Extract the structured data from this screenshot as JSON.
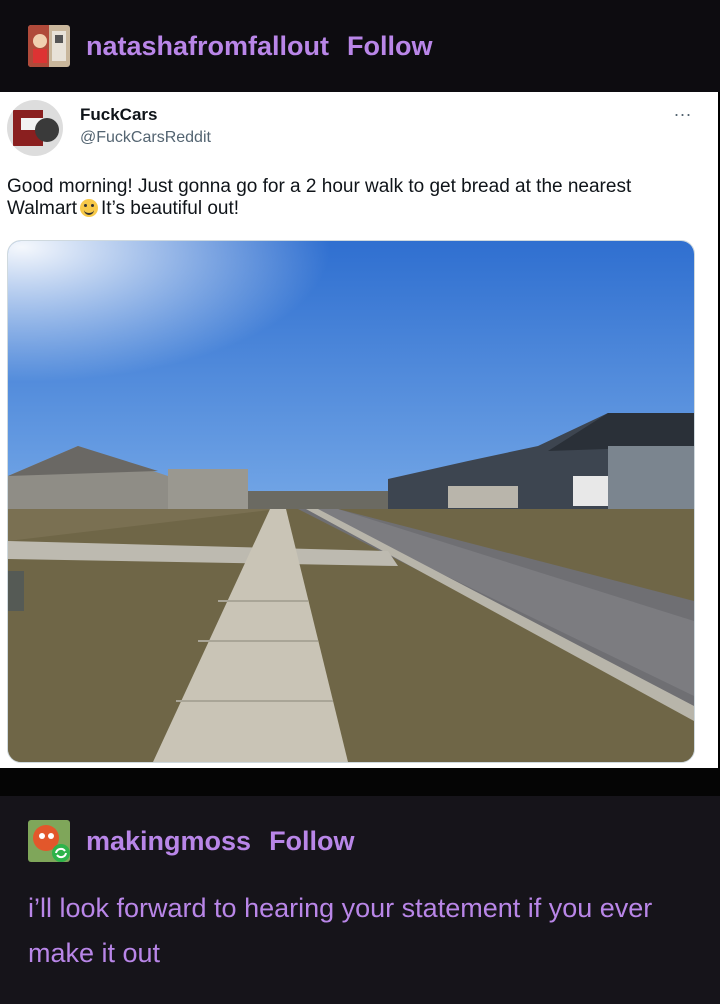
{
  "post": {
    "blog_name": "natashafromfallout",
    "follow_label": "Follow"
  },
  "tweet": {
    "name": "FuckCars",
    "handle": "@FuckCarsReddit",
    "more": "...",
    "text_before_emoji": "Good morning! Just gonna go for a 2 hour walk to get bread at the nearest Walmart",
    "text_after_emoji": "It’s beautiful out!"
  },
  "reblog": {
    "blog_name": "makingmoss",
    "follow_label": "Follow",
    "text": "i’ll look forward to hearing your statement if you ever make it out"
  },
  "colors": {
    "accent": "#b986e8",
    "header_bg": "#0d0c10",
    "reblog_bg": "#16141a"
  }
}
